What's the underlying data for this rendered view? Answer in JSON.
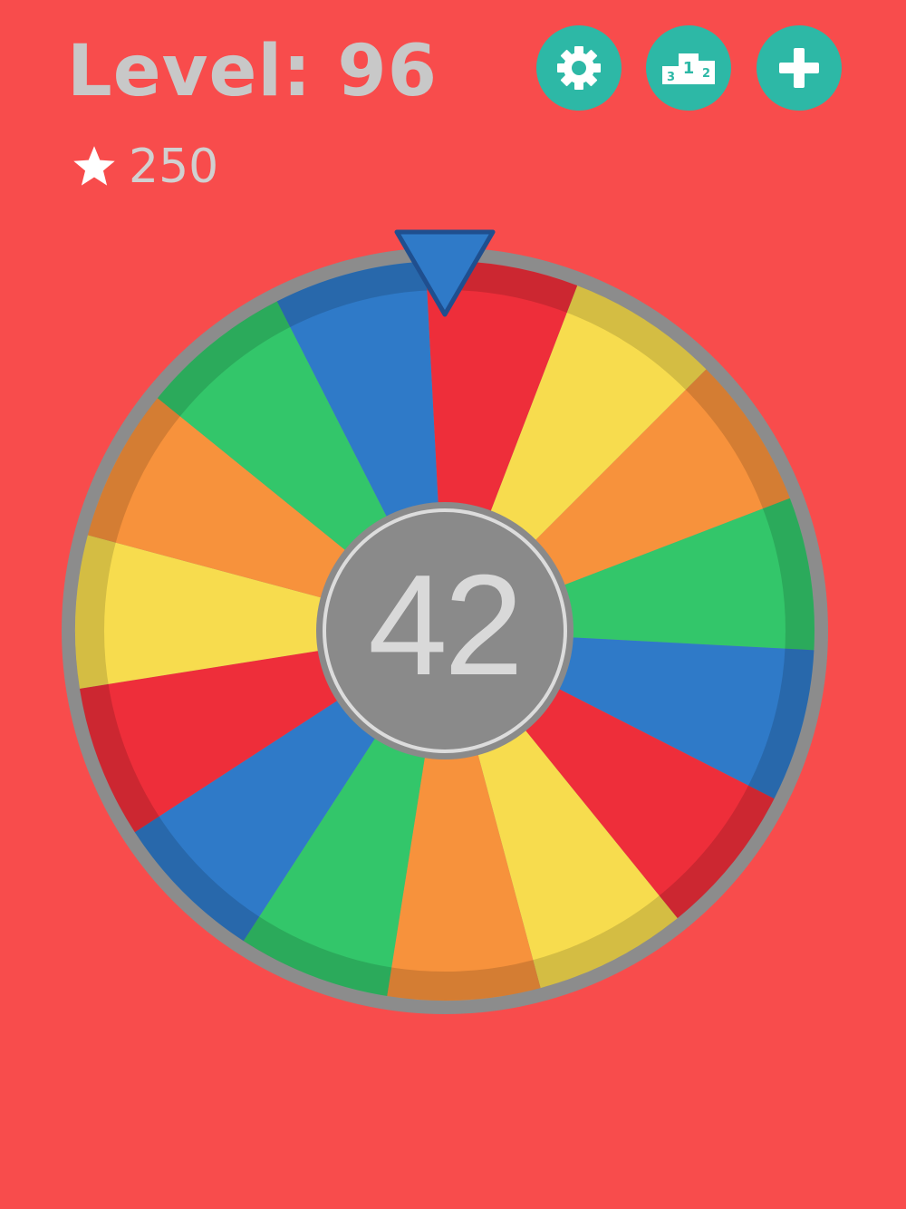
{
  "hud": {
    "level_label": "Level: 96",
    "stars_count": "250"
  },
  "buttons": {
    "settings": "gear-icon",
    "leaderboard": "podium-icon",
    "add": "plus-icon"
  },
  "wheel": {
    "center_number": "42",
    "pointer_color": "#2f7ac8",
    "segments": [
      {
        "color": "#ee2e3a"
      },
      {
        "color": "#f7dc4e"
      },
      {
        "color": "#f7923c"
      },
      {
        "color": "#33c66a"
      },
      {
        "color": "#2f7ac8"
      },
      {
        "color": "#ee2e3a"
      },
      {
        "color": "#f7dc4e"
      },
      {
        "color": "#f7923c"
      },
      {
        "color": "#33c66a"
      },
      {
        "color": "#2f7ac8"
      },
      {
        "color": "#ee2e3a"
      },
      {
        "color": "#f7dc4e"
      },
      {
        "color": "#f7923c"
      },
      {
        "color": "#33c66a"
      },
      {
        "color": "#2f7ac8"
      }
    ]
  },
  "colors": {
    "background": "#f84c4c",
    "button": "#2db8a6",
    "hub": "#8a8a8a",
    "rim": "#8c8c8c",
    "text": "#c8c8c8"
  }
}
